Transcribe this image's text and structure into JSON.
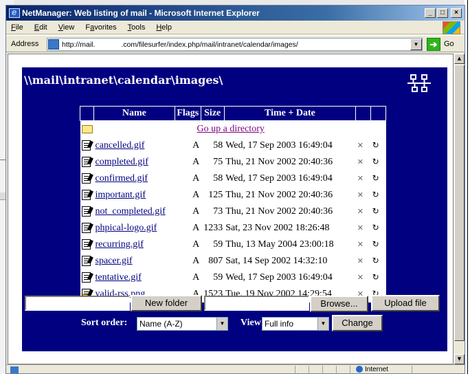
{
  "window": {
    "title": "NetManager: Web listing of mail - Microsoft Internet Explorer",
    "controls": [
      "_",
      "□",
      "×"
    ]
  },
  "menu": [
    {
      "accel": "F",
      "rest": "ile"
    },
    {
      "accel": "E",
      "rest": "dit"
    },
    {
      "accel": "V",
      "rest": "iew"
    },
    {
      "pre": "F",
      "accel": "a",
      "rest": "vorites"
    },
    {
      "accel": "T",
      "rest": "ools"
    },
    {
      "accel": "H",
      "rest": "elp"
    }
  ],
  "address": {
    "label": "Address",
    "url": "http://mail.             .com/filesurfer/index.php/mail/intranet/calendar/images/",
    "go_label": "Go"
  },
  "page": {
    "path": "\\\\mail\\intranet\\calendar\\images\\",
    "columns": [
      "",
      "Name",
      "Flags",
      "Size",
      "Time + Date",
      "",
      ""
    ],
    "up_directory": "Go up a directory",
    "files": [
      {
        "name": "cancelled.gif",
        "flags": "A",
        "size": "58",
        "time": "Wed, 17 Sep 2003 16:49:04",
        "type": "gif"
      },
      {
        "name": "completed.gif",
        "flags": "A",
        "size": "75",
        "time": "Thu, 21 Nov 2002 20:40:36",
        "type": "gif"
      },
      {
        "name": "confirmed.gif",
        "flags": "A",
        "size": "58",
        "time": "Wed, 17 Sep 2003 16:49:04",
        "type": "gif"
      },
      {
        "name": "important.gif",
        "flags": "A",
        "size": "125",
        "time": "Thu, 21 Nov 2002 20:40:36",
        "type": "gif"
      },
      {
        "name": "not_completed.gif",
        "flags": "A",
        "size": "73",
        "time": "Thu, 21 Nov 2002 20:40:36",
        "type": "gif"
      },
      {
        "name": "phpical-logo.gif",
        "flags": "A",
        "size": "1233",
        "time": "Sat, 23 Nov 2002 18:26:48",
        "type": "gif"
      },
      {
        "name": "recurring.gif",
        "flags": "A",
        "size": "59",
        "time": "Thu, 13 May 2004 23:00:18",
        "type": "gif"
      },
      {
        "name": "spacer.gif",
        "flags": "A",
        "size": "807",
        "time": "Sat, 14 Sep 2002 14:32:10",
        "type": "gif"
      },
      {
        "name": "tentative.gif",
        "flags": "A",
        "size": "59",
        "time": "Wed, 17 Sep 2003 16:49:04",
        "type": "gif"
      },
      {
        "name": "valid-rss.png",
        "flags": "A",
        "size": "1523",
        "time": "Tue, 19 Nov 2002 14:29:54",
        "type": "png"
      }
    ],
    "new_folder_label": "New folder",
    "browse_label": "Browse...",
    "upload_label": "Upload file",
    "sort_label": "Sort order:",
    "sort_value": "Name (A-Z)",
    "view_label": "View:",
    "view_value": "Full info",
    "change_label": "Change"
  },
  "status": {
    "zone": "Internet"
  }
}
